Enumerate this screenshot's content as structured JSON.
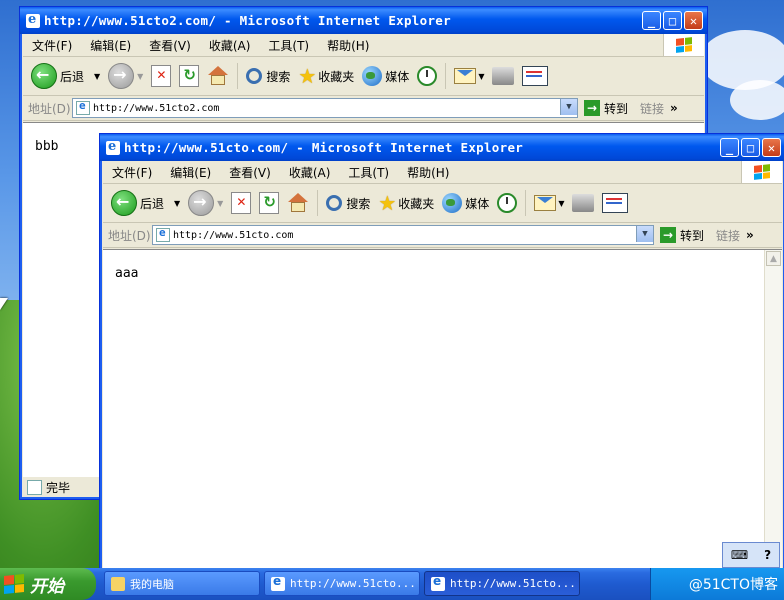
{
  "back_window": {
    "title": "http://www.51cto2.com/ - Microsoft Internet Explorer",
    "menu": [
      "文件(F)",
      "编辑(E)",
      "查看(V)",
      "收藏(A)",
      "工具(T)",
      "帮助(H)"
    ],
    "toolbar": {
      "back": "后退",
      "search": "搜索",
      "favorites": "收藏夹",
      "media": "媒体"
    },
    "address_label": "地址(D)",
    "address": "http://www.51cto2.com",
    "go": "转到",
    "links": "链接",
    "page_text": "bbb",
    "status": "完毕"
  },
  "front_window": {
    "title": "http://www.51cto.com/ - Microsoft Internet Explorer",
    "menu": [
      "文件(F)",
      "编辑(E)",
      "查看(V)",
      "收藏(A)",
      "工具(T)",
      "帮助(H)"
    ],
    "toolbar": {
      "back": "后退",
      "search": "搜索",
      "favorites": "收藏夹",
      "media": "媒体"
    },
    "address_label": "地址(D)",
    "address": "http://www.51cto.com",
    "go": "转到",
    "links": "链接",
    "page_text": "aaa"
  },
  "taskbar": {
    "start": "开始",
    "tasks": [
      {
        "label": "我的电脑",
        "icon": "folder-icon"
      },
      {
        "label": "http://www.51cto...",
        "icon": "ie-icon"
      },
      {
        "label": "http://www.51cto...",
        "icon": "ie-icon"
      }
    ],
    "tray_text": "@51CTO博客"
  },
  "colors": {
    "xp_blue": "#0058ee",
    "close_red": "#c33b18",
    "start_green": "#3a9a2e"
  }
}
